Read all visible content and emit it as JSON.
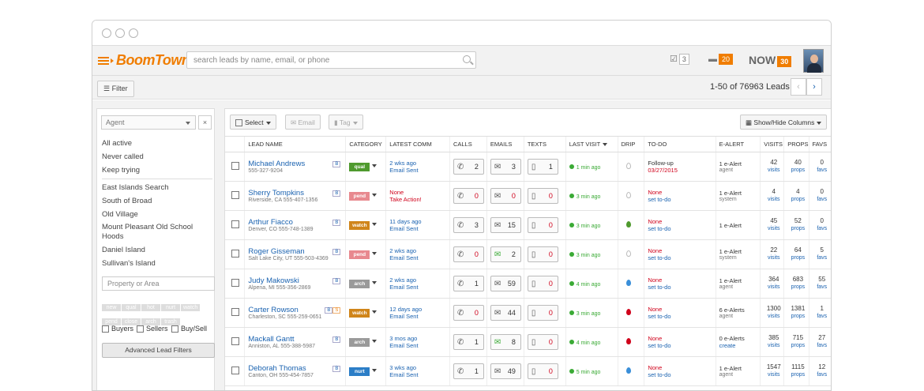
{
  "header": {
    "logo": "BoomTown!",
    "search_placeholder": "search leads by name, email, or phone",
    "tasks_count": "3",
    "messages_count": "20",
    "now_label": "NOW",
    "now_count": "30"
  },
  "toolbar": {
    "filter_label": "Filter",
    "count_text": "1-50 of 76963 Leads",
    "prev": "‹",
    "next": "›"
  },
  "sidebar": {
    "agent_placeholder": "Agent",
    "agent_clear": "×",
    "group1": [
      "All active",
      "Never called",
      "Keep trying"
    ],
    "group2": [
      "East Islands Search",
      "South of Broad",
      "Old Village",
      "Mount Pleasant Old School Hoods",
      "Daniel Island",
      "Sullivan's Island"
    ],
    "property_placeholder": "Property or Area",
    "tags": [
      "new",
      "qual",
      "hot",
      "nurt",
      "watch",
      "pend",
      "close",
      "arch",
      "trash"
    ],
    "buyers": "Buyers",
    "sellers": "Sellers",
    "buysell": "Buy/Sell",
    "advanced": "Advanced Lead Filters"
  },
  "actions": {
    "select": "Select",
    "email": "Email",
    "tag": "Tag",
    "columns": "Show/Hide Columns"
  },
  "columns": [
    "LEAD NAME",
    "CATEGORY",
    "LATEST COMM",
    "CALLS",
    "EMAILS",
    "TEXTS",
    "LAST VISIT",
    "DRIP",
    "TO-DO",
    "E-ALERT",
    "VISITS",
    "PROPS",
    "FAVS"
  ],
  "colors": {
    "qual": "#4f9a2e",
    "pend": "#e8898f",
    "watch": "#d0851a",
    "arch": "#9a9a9a",
    "nurt": "#2c7ec7"
  },
  "leads": [
    {
      "name": "Michael Andrews",
      "loc": "555-327-9204",
      "badges": [
        "B"
      ],
      "cat": "qual",
      "comm1": "2 wks ago",
      "comm2": "Email Sent",
      "comm_red": false,
      "calls": "2",
      "emails": "3",
      "texts": "1",
      "visit": "1 min ago",
      "drip": "#bbb",
      "todo1": "Follow-up",
      "todo2": "03/27/2015",
      "todo_red": false,
      "ea1": "1 e-Alert",
      "ea2": "agent",
      "ea2_link": false,
      "visits": "42",
      "props": "40",
      "favs": "0"
    },
    {
      "name": "Sherry Tompkins",
      "loc": "Riverside, CA  555-407-1356",
      "badges": [
        "B"
      ],
      "cat": "pend",
      "comm1": "None",
      "comm2": "Take Action!",
      "comm_red": true,
      "calls": "0",
      "emails": "0",
      "texts": "0",
      "visit": "3 min ago",
      "drip": "#bbb",
      "todo1": "None",
      "todo2": "set to-do",
      "todo_red": true,
      "ea1": "1 e-Alert",
      "ea2": "system",
      "ea2_link": false,
      "visits": "4",
      "props": "4",
      "favs": "0"
    },
    {
      "name": "Arthur Fiacco",
      "loc": "Denver, CO  555-748-1389",
      "badges": [
        "B"
      ],
      "cat": "watch",
      "comm1": "11 days ago",
      "comm2": "Email Sent",
      "comm_red": false,
      "calls": "3",
      "emails": "15",
      "texts": "0",
      "visit": "3 min ago",
      "drip": "#4f9a2e",
      "todo1": "None",
      "todo2": "set to-do",
      "todo_red": true,
      "ea1": "1 e-Alert",
      "ea2": "",
      "ea2_link": false,
      "visits": "45",
      "props": "52",
      "favs": "0"
    },
    {
      "name": "Roger Gisseman",
      "loc": "Salt Lake City, UT  555-503-4369",
      "badges": [
        "B"
      ],
      "cat": "pend",
      "comm1": "2 wks ago",
      "comm2": "Email Sent",
      "comm_red": false,
      "calls": "0",
      "emails": "2",
      "texts": "0",
      "visit": "3 min ago",
      "drip": "#bbb",
      "todo1": "None",
      "todo2": "set to-do",
      "todo_red": true,
      "ea1": "1 e-Alert",
      "ea2": "system",
      "ea2_link": false,
      "visits": "22",
      "props": "64",
      "favs": "5"
    },
    {
      "name": "Judy Makowski",
      "loc": "Alpena, MI  555-356-2869",
      "badges": [
        "B"
      ],
      "cat": "arch",
      "comm1": "2 wks ago",
      "comm2": "Email Sent",
      "comm_red": false,
      "calls": "1",
      "emails": "59",
      "texts": "0",
      "visit": "4 min ago",
      "drip": "#3a8fd9",
      "todo1": "None",
      "todo2": "set to-do",
      "todo_red": true,
      "ea1": "1 e-Alert",
      "ea2": "agent",
      "ea2_link": false,
      "visits": "364",
      "props": "683",
      "favs": "55"
    },
    {
      "name": "Carter Rowson",
      "loc": "Charleston, SC  555-259-0651",
      "badges": [
        "B",
        "S"
      ],
      "cat": "watch",
      "comm1": "12 days ago",
      "comm2": "Email Sent",
      "comm_red": false,
      "calls": "0",
      "emails": "44",
      "texts": "0",
      "visit": "3 min ago",
      "drip": "#d0021b",
      "todo1": "None",
      "todo2": "set to-do",
      "todo_red": true,
      "ea1": "6 e-Alerts",
      "ea2": "agent",
      "ea2_link": false,
      "visits": "1300",
      "props": "1381",
      "favs": "1"
    },
    {
      "name": "Mackall Gantt",
      "loc": "Anniston, AL  555-388-5987",
      "badges": [
        "B"
      ],
      "cat": "arch",
      "comm1": "3 mos ago",
      "comm2": "Email Sent",
      "comm_red": false,
      "calls": "1",
      "emails": "8",
      "texts": "0",
      "visit": "4 min ago",
      "drip": "#d0021b",
      "todo1": "None",
      "todo2": "set to-do",
      "todo_red": true,
      "ea1": "0 e-Alerts",
      "ea2": "create",
      "ea2_link": true,
      "visits": "385",
      "props": "715",
      "favs": "27"
    },
    {
      "name": "Deborah Thomas",
      "loc": "Canton, OH  555-454-7857",
      "badges": [
        "B"
      ],
      "cat": "nurt",
      "comm1": "3 wks ago",
      "comm2": "Email Sent",
      "comm_red": false,
      "calls": "1",
      "emails": "49",
      "texts": "0",
      "visit": "5 min ago",
      "drip": "#3a8fd9",
      "todo1": "None",
      "todo2": "set to-do",
      "todo_red": true,
      "ea1": "1 e-Alert",
      "ea2": "agent",
      "ea2_link": false,
      "visits": "1547",
      "props": "1115",
      "favs": "12"
    }
  ],
  "cell_links": {
    "visits": "visits",
    "props": "props",
    "favs": "favs"
  }
}
